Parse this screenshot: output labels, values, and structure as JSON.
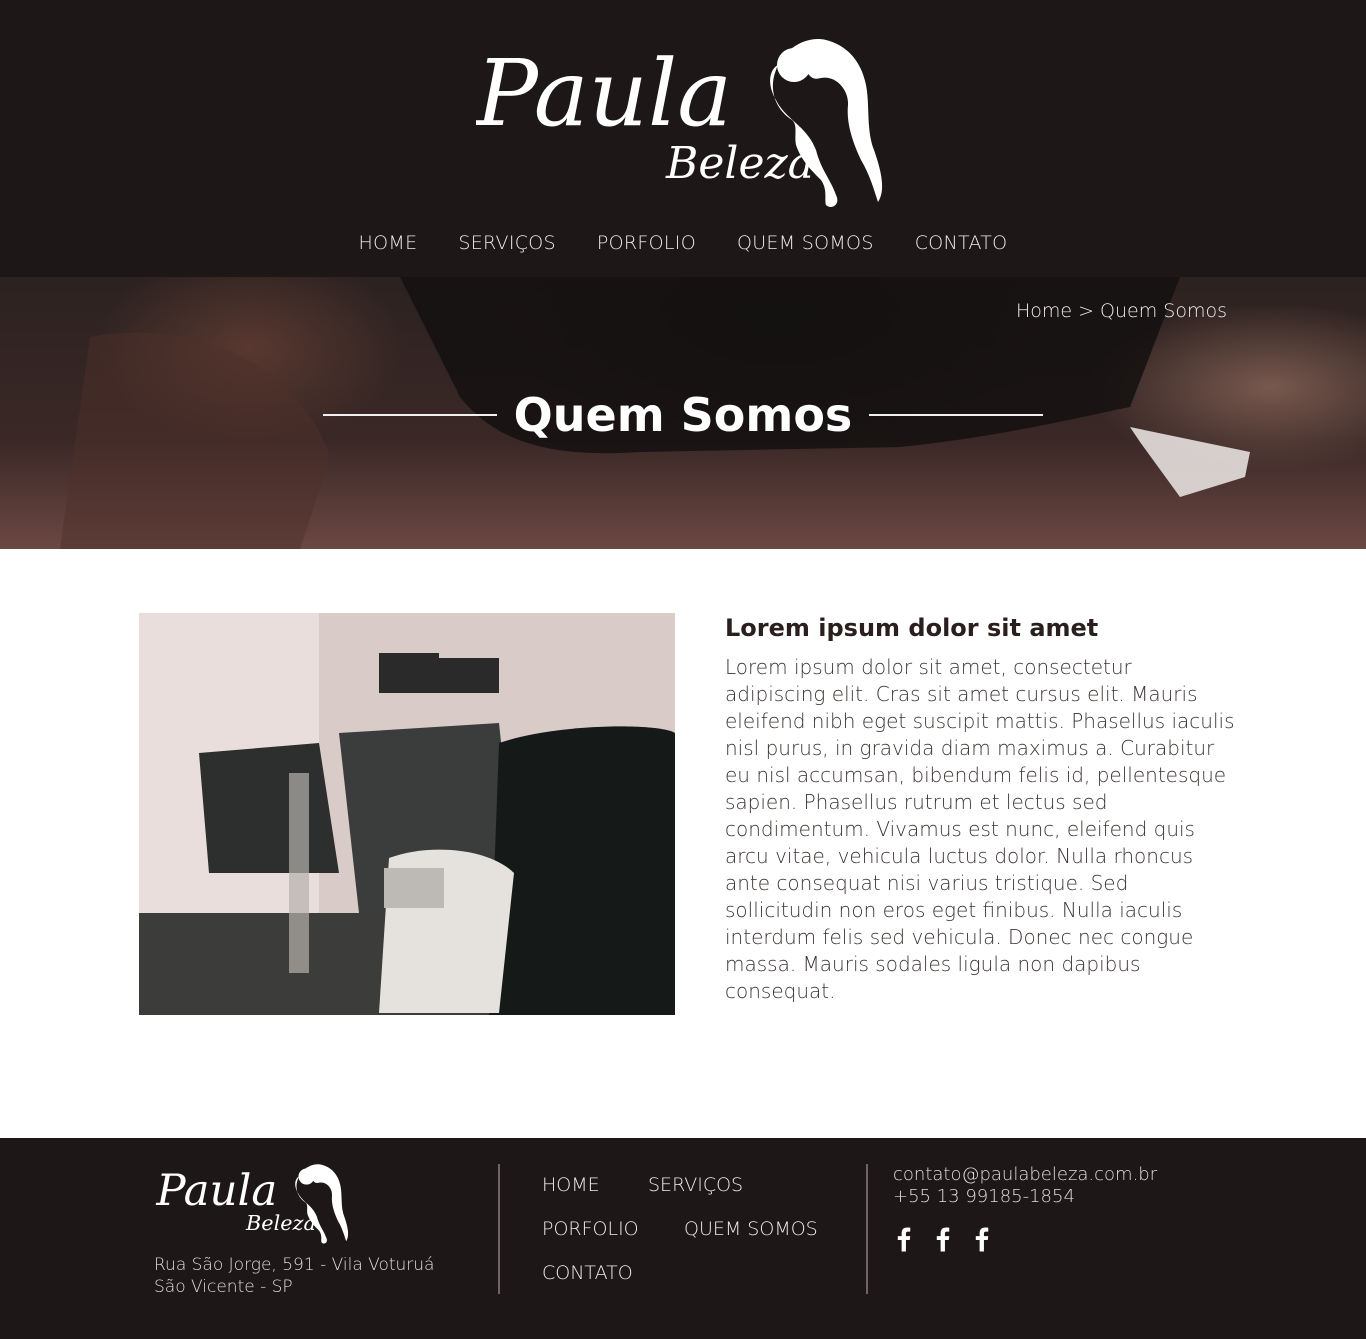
{
  "brand": {
    "name": "Paula",
    "subname": "Beleza"
  },
  "nav": {
    "items": [
      {
        "label": "HOME"
      },
      {
        "label": "SERVIÇOS"
      },
      {
        "label": "PORFOLIO"
      },
      {
        "label": "QUEM SOMOS"
      },
      {
        "label": "CONTATO"
      }
    ]
  },
  "hero": {
    "breadcrumb_home": "Home",
    "breadcrumb_sep": " > ",
    "breadcrumb_current": "Quem Somos",
    "title": "Quem Somos"
  },
  "article": {
    "heading": "Lorem ipsum dolor sit amet",
    "body": "Lorem ipsum dolor sit amet, consectetur adipiscing elit. Cras sit amet cursus elit. Mauris eleifend nibh eget suscipit mattis. Phasellus iaculis nisl purus, in gravida diam maximus a. Curabitur eu nisl accumsan, bibendum felis id, pellentesque sapien. Phasellus rutrum et lectus sed condimentum. Vivamus est nunc, eleifend quis arcu vitae, vehicula luctus dolor. Nulla rhoncus ante consequat nisi varius tristique. Sed sollicitudin non eros eget finibus. Nulla iaculis interdum felis sed vehicula. Donec nec congue massa. Mauris sodales ligula non dapibus consequat."
  },
  "footer": {
    "address_line1": "Rua São Jorge, 591 -  Vila Voturuá",
    "address_line2": "São Vicente - SP",
    "nav": [
      {
        "label": "HOME"
      },
      {
        "label": "SERVIÇOS"
      },
      {
        "label": "PORFOLIO"
      },
      {
        "label": "QUEM SOMOS"
      },
      {
        "label": "CONTATO"
      }
    ],
    "email": "contato@paulabeleza.com.br",
    "phone": "+55 13 99185-1854",
    "social": [
      {
        "icon": "facebook-icon"
      },
      {
        "icon": "facebook-icon"
      },
      {
        "icon": "facebook-icon"
      }
    ]
  },
  "colors": {
    "header_bg": "#1d1817",
    "heading_text": "#2a1f1d",
    "body_text": "#3b3331"
  }
}
